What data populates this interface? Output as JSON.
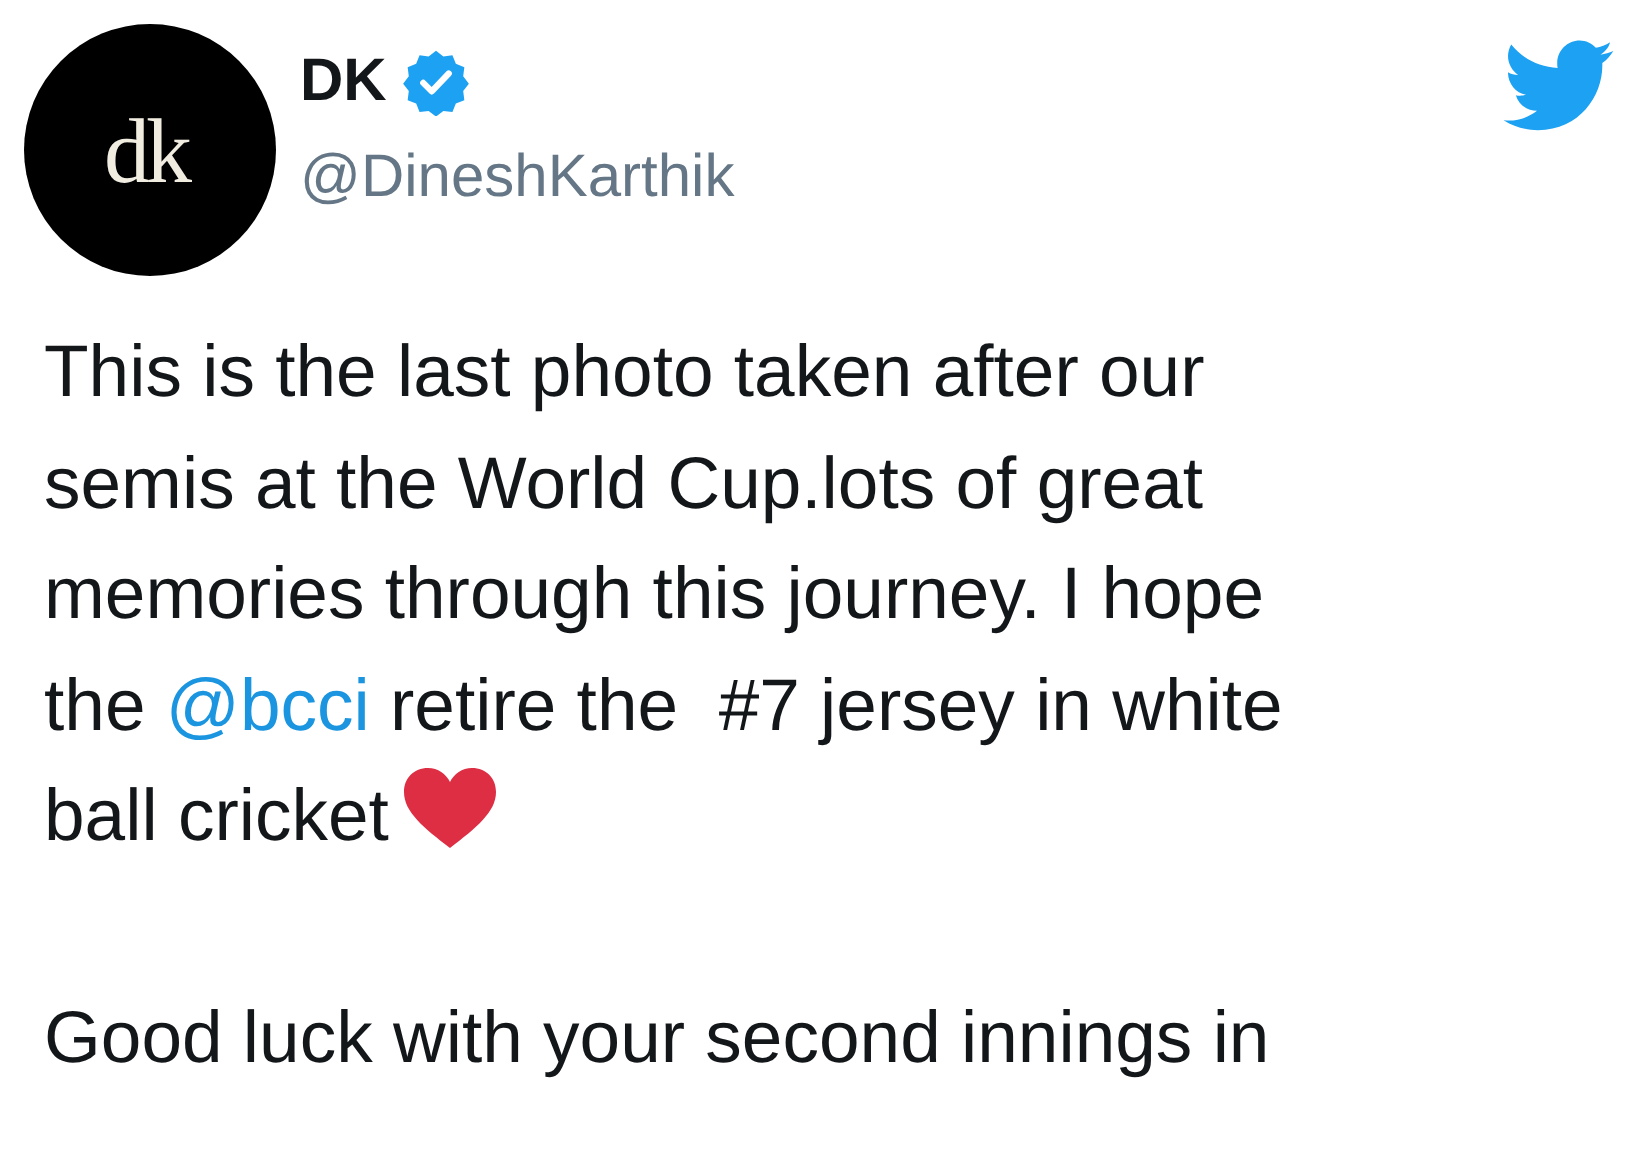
{
  "author": {
    "avatar_text": "dk",
    "name": "DK",
    "verified": true,
    "handle": "@DineshKarthik"
  },
  "paragraphs": [
    {
      "segments": [
        {
          "kind": "text",
          "text": "This is the last photo taken after our\nsemis at the World Cup.lots of great\nmemories through this journey. I hope\nthe "
        },
        {
          "kind": "mention",
          "text": "@bcci"
        },
        {
          "kind": "text",
          "text": " retire the  #7 jersey in white\nball cricket"
        },
        {
          "kind": "heart"
        }
      ]
    },
    {
      "segments": [
        {
          "kind": "text",
          "text": "Good luck with your second innings in"
        }
      ]
    }
  ]
}
